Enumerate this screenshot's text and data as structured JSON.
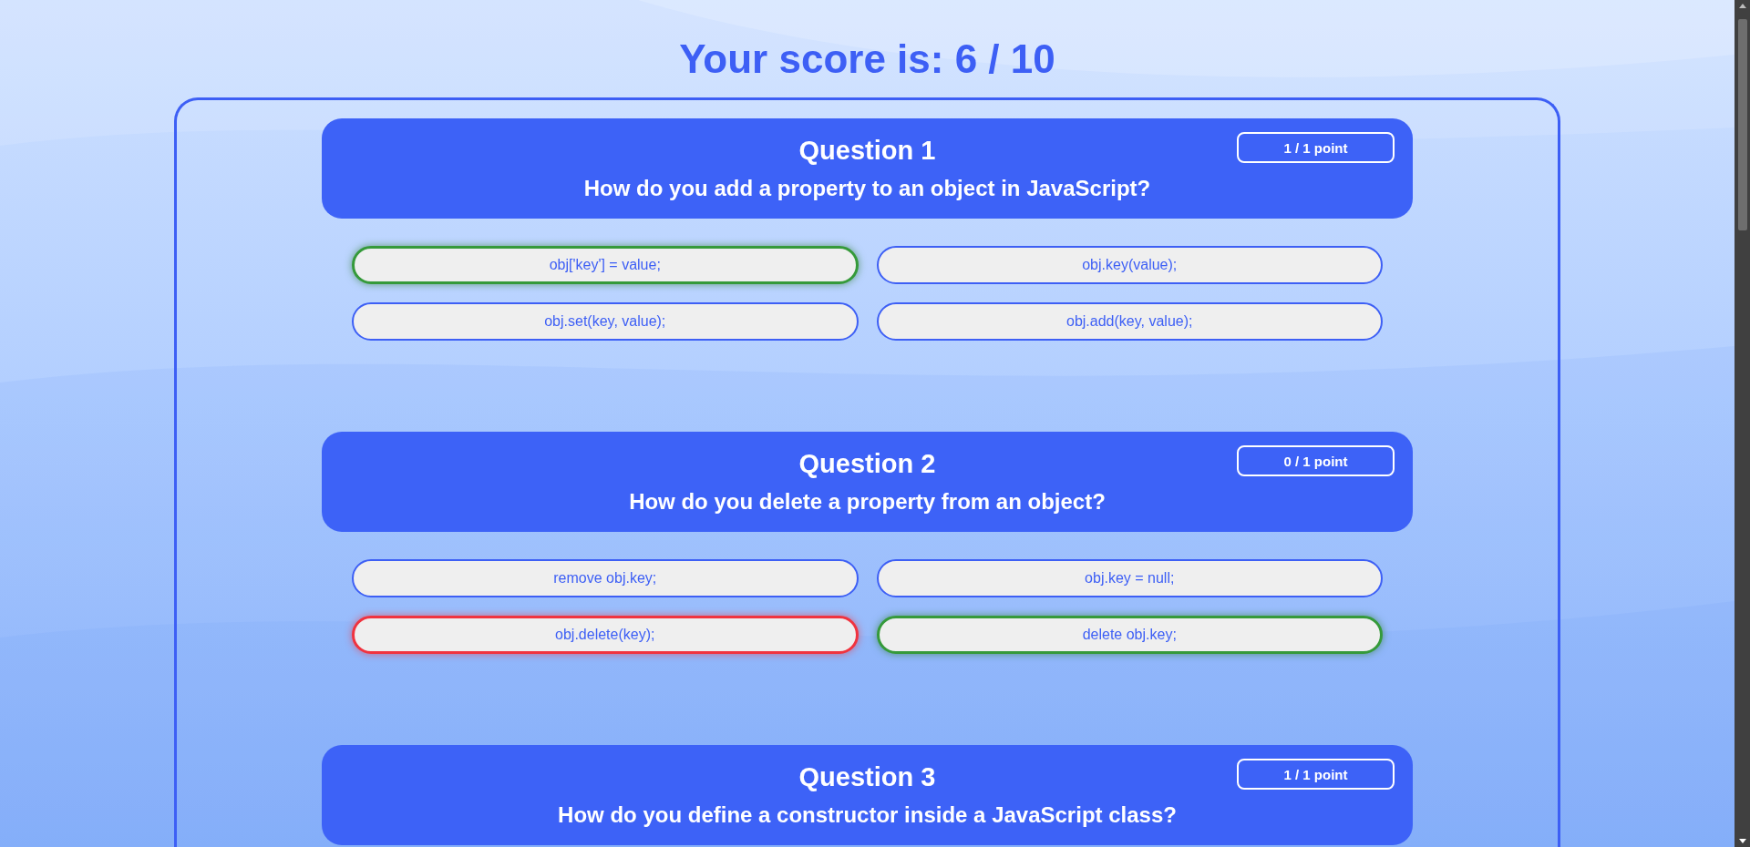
{
  "score_title": "Your score is: 6 / 10",
  "questions": [
    {
      "heading": "Question 1",
      "text": "How do you add a property to an object in JavaScript?",
      "points": "1 / 1 point",
      "options": [
        {
          "label": "obj['key'] = value;",
          "correct": true,
          "wrong": false
        },
        {
          "label": "obj.key(value);",
          "correct": false,
          "wrong": false
        },
        {
          "label": "obj.set(key, value);",
          "correct": false,
          "wrong": false
        },
        {
          "label": "obj.add(key, value);",
          "correct": false,
          "wrong": false
        }
      ]
    },
    {
      "heading": "Question 2",
      "text": "How do you delete a property from an object?",
      "points": "0 / 1 point",
      "options": [
        {
          "label": "remove obj.key;",
          "correct": false,
          "wrong": false
        },
        {
          "label": "obj.key = null;",
          "correct": false,
          "wrong": false
        },
        {
          "label": "obj.delete(key);",
          "correct": false,
          "wrong": true
        },
        {
          "label": "delete obj.key;",
          "correct": true,
          "wrong": false
        }
      ]
    },
    {
      "heading": "Question 3",
      "text": "How do you define a constructor inside a JavaScript class?",
      "points": "1 / 1 point"
    }
  ]
}
